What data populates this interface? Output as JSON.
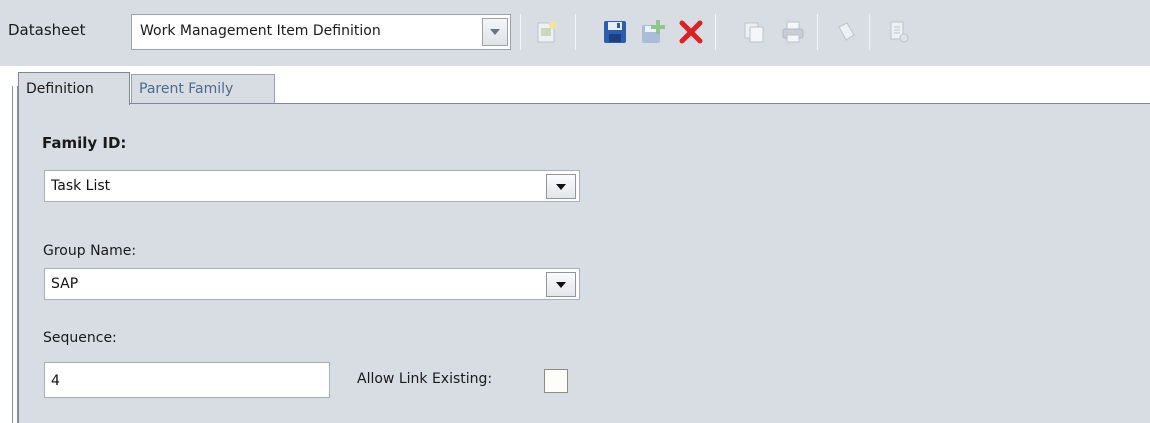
{
  "toolbar": {
    "datasheet_label": "Datasheet",
    "datasheet_value": "Work Management Item Definition",
    "icons": [
      "new-record-icon",
      "save-icon",
      "save-new-icon",
      "delete-icon",
      "copy-icon",
      "print-icon",
      "clear-icon",
      "report-icon"
    ]
  },
  "tabs": [
    {
      "label": "Definition",
      "active": true
    },
    {
      "label": "Parent Family",
      "active": false
    }
  ],
  "form": {
    "family_id_label": "Family ID:",
    "family_id_value": "Task List",
    "group_name_label": "Group Name:",
    "group_name_value": "SAP",
    "sequence_label": "Sequence:",
    "sequence_value": "4",
    "allow_link_label": "Allow Link Existing:",
    "allow_link_checked": false
  },
  "colors": {
    "panel_bg": "#d8dde3",
    "delete_red": "#e02020",
    "save_blue": "#2a5db0",
    "add_green": "#3cae3c"
  }
}
